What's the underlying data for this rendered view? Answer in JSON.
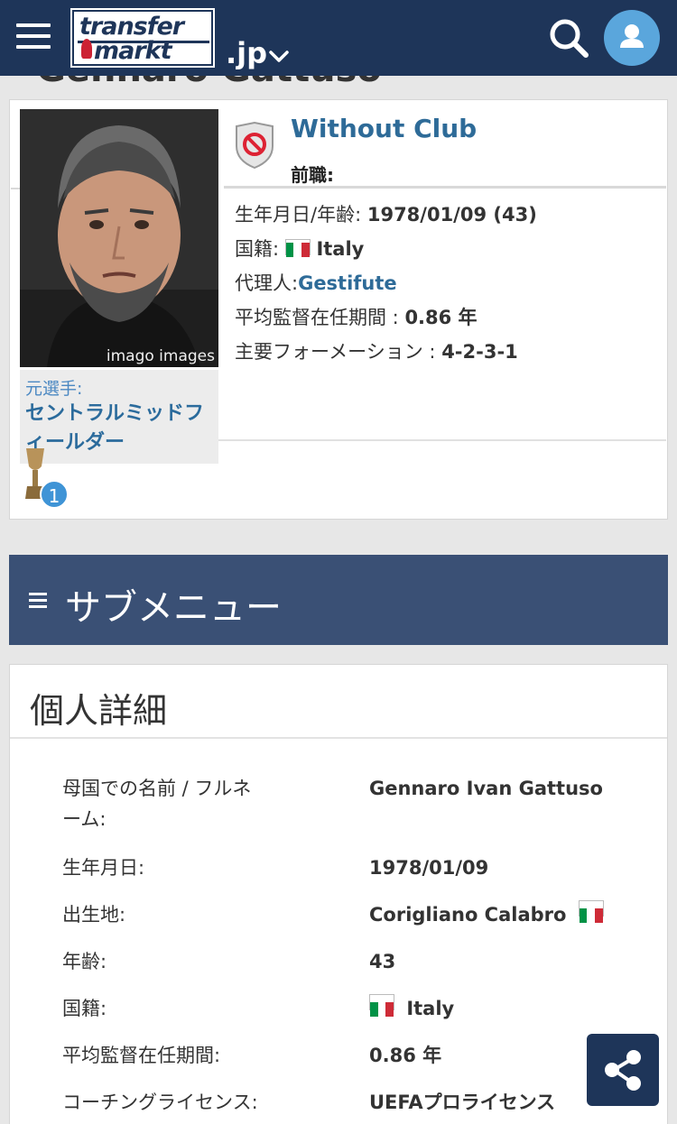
{
  "header": {
    "logo_line1": "transfer",
    "logo_line2": "markt",
    "tld": ".jp",
    "menu_icon": "hamburger-menu-icon",
    "search_icon": "search-icon",
    "user_icon": "user-icon",
    "bg_color": "#1e3559"
  },
  "ghost_title": "Gennaro Gattuso",
  "profile": {
    "photo_credit": "imago images",
    "position_label": "元選手:",
    "position_value": "セントラルミッドフィールダー",
    "trophy_count": "1",
    "club_name": "Without Club",
    "previous_label": "前職:",
    "birth_label": "生年月日/年齢:",
    "birth_value": "1978/01/09 (43)",
    "nationality_label": "国籍:",
    "nationality_value": "Italy",
    "agent_label": "代理人:",
    "agent_value": "Gestifute",
    "tenure_label": "平均監督在任期間 :",
    "tenure_value": "0.86 年",
    "formation_label": "主要フォーメーション :",
    "formation_value": "4-2-3-1"
  },
  "submenu": {
    "label": "サブメニュー",
    "bg_color": "#3a5075"
  },
  "details": {
    "title": "個人詳細",
    "rows": [
      {
        "label": "母国での名前 / フルネーム:",
        "value": "Gennaro Ivan Gattuso"
      },
      {
        "label": "生年月日:",
        "value": "1978/01/09"
      },
      {
        "label": "出生地:",
        "value": "Corigliano Calabro"
      },
      {
        "label": "年齢:",
        "value": "43"
      },
      {
        "label": "国籍:",
        "value": "Italy"
      },
      {
        "label": "平均監督在任期間:",
        "value": "0.86 年"
      },
      {
        "label": "コーチングライセンス:",
        "value": "UEFAプロライセンス"
      }
    ]
  },
  "colors": {
    "link": "#2e6b98",
    "accent_blue": "#5aa6dc",
    "italy_green": "#009246",
    "italy_white": "#ffffff",
    "italy_red": "#ce2b37"
  },
  "share_icon": "share-icon"
}
